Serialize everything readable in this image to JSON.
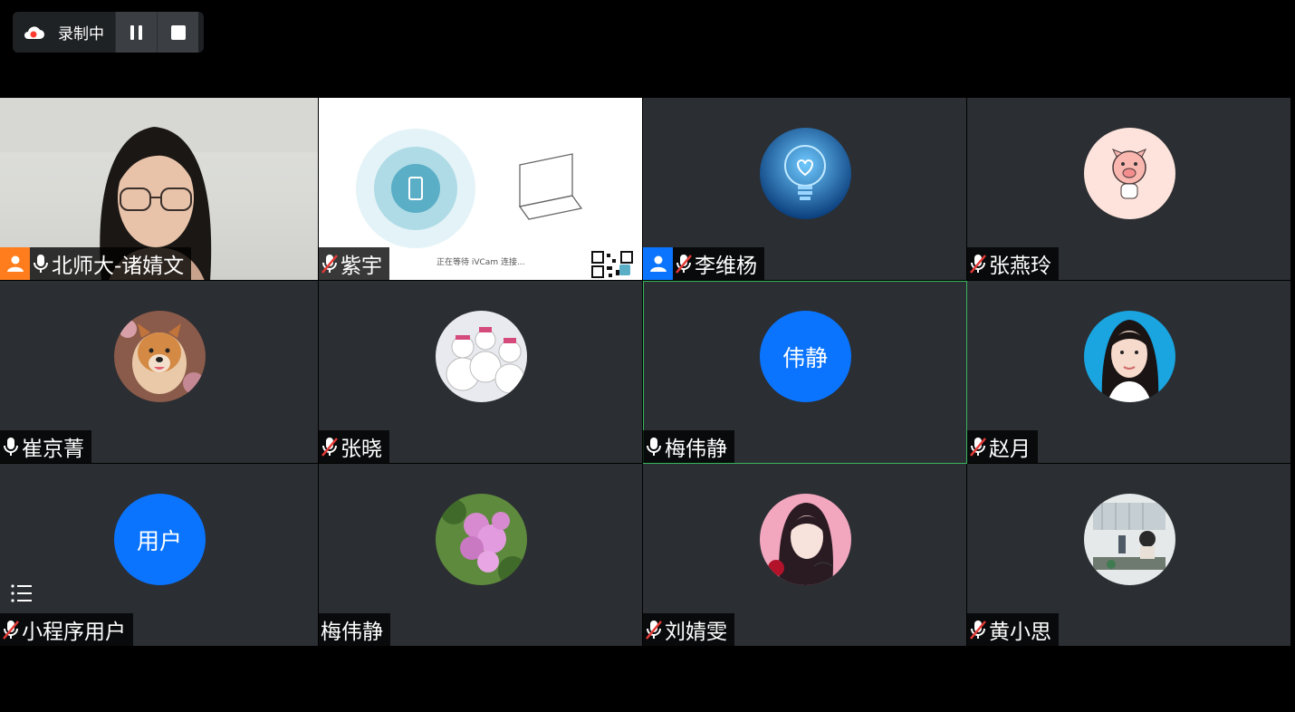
{
  "recording": {
    "label": "录制中",
    "pause": "pause-icon",
    "stop": "stop-icon"
  },
  "ivcam": {
    "waiting": "正在等待 iVCam 连接..."
  },
  "tiles": [
    {
      "name": "北师大-诸婧文",
      "mic": "on",
      "host": "orange"
    },
    {
      "name": "紫宇",
      "mic": "muted"
    },
    {
      "name": "李维杨",
      "mic": "muted",
      "host": "blue"
    },
    {
      "name": "张燕玲",
      "mic": "muted"
    },
    {
      "name": "崔京菁",
      "mic": "on"
    },
    {
      "name": "张晓",
      "mic": "muted"
    },
    {
      "name": "梅伟静",
      "mic": "on",
      "avatar_text": "伟静"
    },
    {
      "name": "赵月",
      "mic": "muted"
    },
    {
      "name": "小程序用户",
      "mic": "muted",
      "avatar_text": "用户"
    },
    {
      "name": "梅伟静",
      "mic": "none"
    },
    {
      "name": "刘婧雯",
      "mic": "muted"
    },
    {
      "name": "黄小思",
      "mic": "muted"
    }
  ],
  "colors": {
    "accent": "#0a74ff",
    "active_border": "#36b55c",
    "tile_bg": "#2b2e32"
  }
}
